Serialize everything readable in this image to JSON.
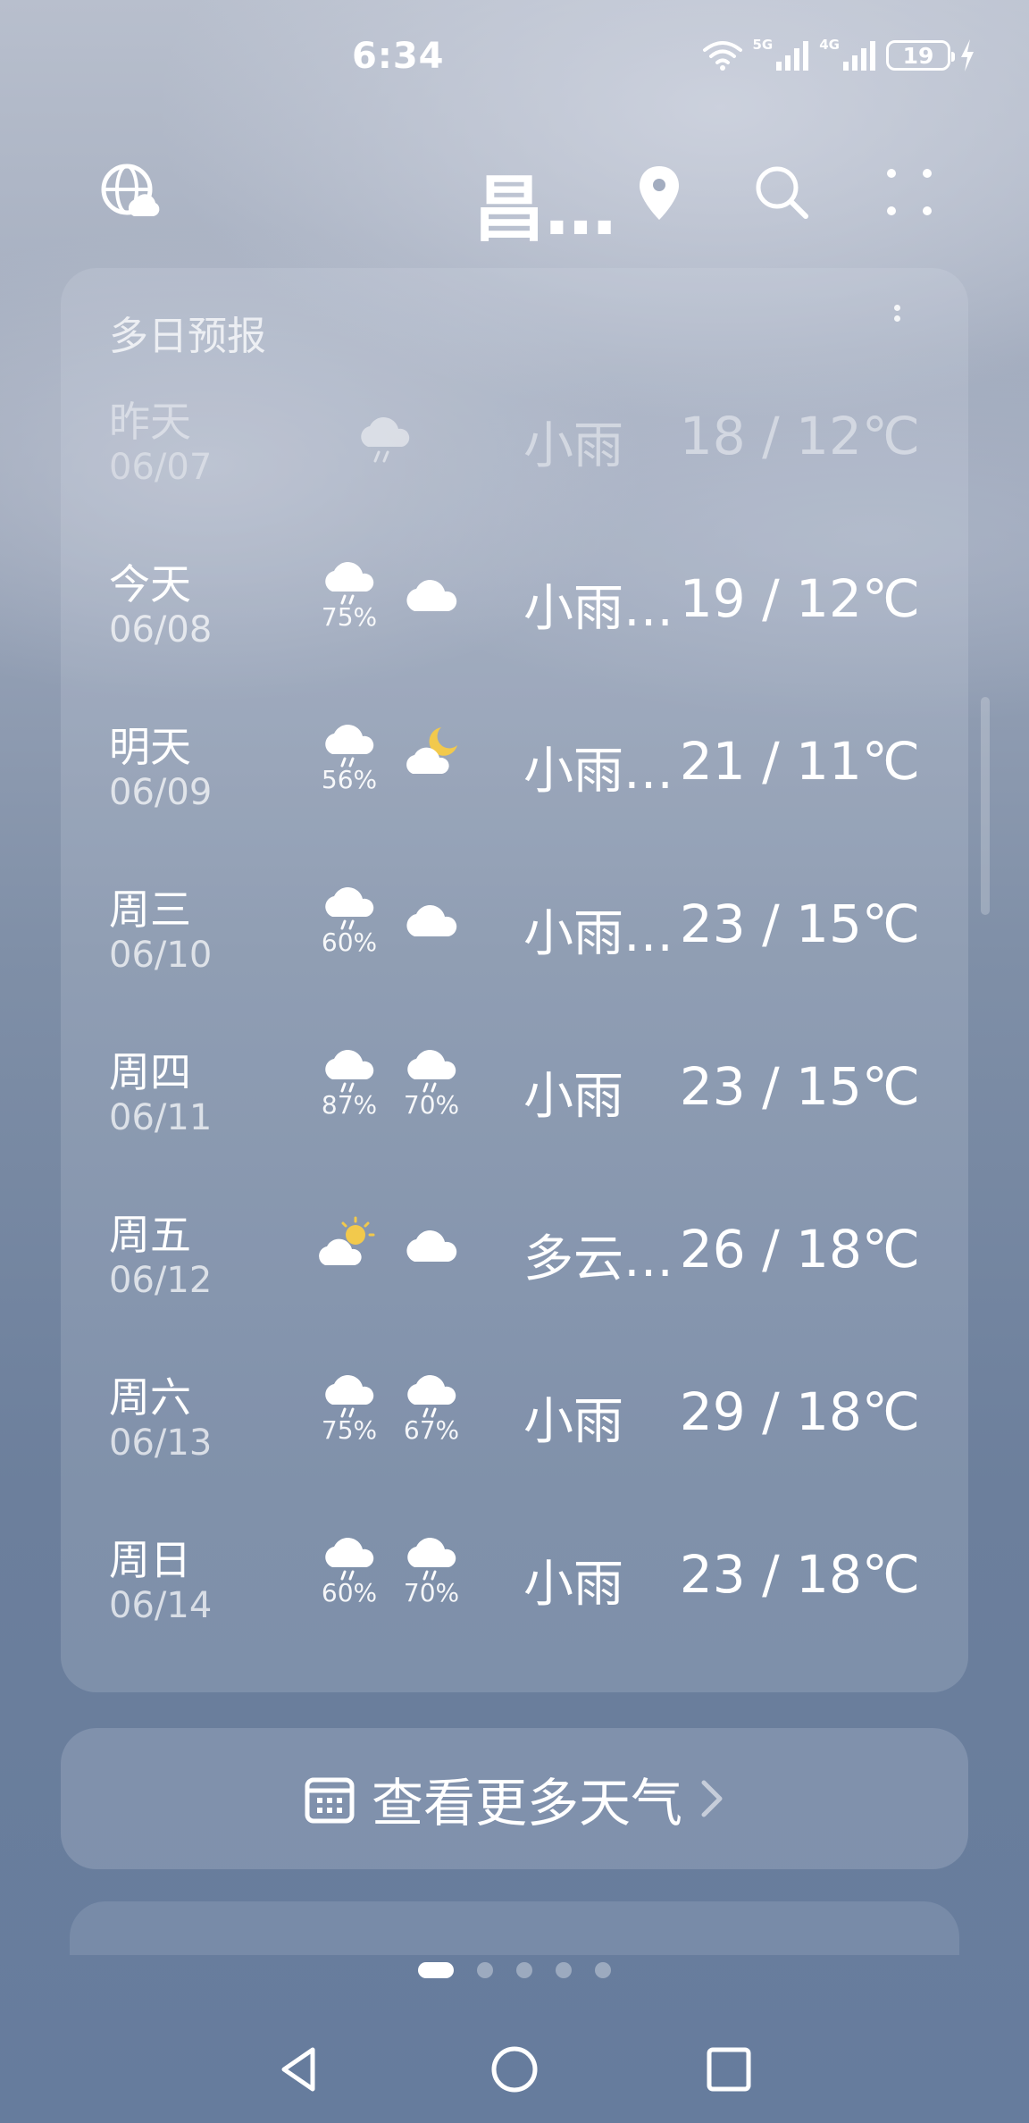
{
  "status_bar": {
    "time": "6:34",
    "signal_1_label": "5G",
    "signal_2_label": "4G",
    "battery_level": "19"
  },
  "header": {
    "city": "昌…"
  },
  "forecast": {
    "title": "多日预报",
    "days": [
      {
        "name": "昨天",
        "date": "06/07",
        "icon_day": "cloud-rain-icon",
        "precip_day": "",
        "icon_night": "",
        "precip_night": "",
        "condition": "小雨",
        "temp": "18 / 12℃",
        "past": true
      },
      {
        "name": "今天",
        "date": "06/08",
        "icon_day": "cloud-rain-icon",
        "precip_day": "75%",
        "icon_night": "cloud-icon",
        "precip_night": "",
        "condition": "小雨…",
        "temp": "19 / 12℃"
      },
      {
        "name": "明天",
        "date": "06/09",
        "icon_day": "cloud-rain-icon",
        "precip_day": "56%",
        "icon_night": "moon-cloud-icon",
        "precip_night": "",
        "condition": "小雨…",
        "temp": "21 / 11℃"
      },
      {
        "name": "周三",
        "date": "06/10",
        "icon_day": "cloud-rain-icon",
        "precip_day": "60%",
        "icon_night": "cloud-icon",
        "precip_night": "",
        "condition": "小雨…",
        "temp": "23 / 15℃"
      },
      {
        "name": "周四",
        "date": "06/11",
        "icon_day": "cloud-rain-icon",
        "precip_day": "87%",
        "icon_night": "cloud-rain-icon",
        "precip_night": "70%",
        "condition": "小雨",
        "temp": "23 / 15℃"
      },
      {
        "name": "周五",
        "date": "06/12",
        "icon_day": "sun-cloud-icon",
        "precip_day": "",
        "icon_night": "cloud-icon",
        "precip_night": "",
        "condition": "多云…",
        "temp": "26 / 18℃"
      },
      {
        "name": "周六",
        "date": "06/13",
        "icon_day": "cloud-rain-icon",
        "precip_day": "75%",
        "icon_night": "cloud-rain-icon",
        "precip_night": "67%",
        "condition": "小雨",
        "temp": "29 / 18℃"
      },
      {
        "name": "周日",
        "date": "06/14",
        "icon_day": "cloud-rain-icon",
        "precip_day": "60%",
        "icon_night": "cloud-rain-icon",
        "precip_night": "70%",
        "condition": "小雨",
        "temp": "23 / 18℃"
      }
    ]
  },
  "more_weather": {
    "label": "查看更多天气",
    "icon": "calendar-icon"
  },
  "page_indicator": {
    "current": 1,
    "total": 5
  },
  "nav": {
    "back_icon": "back-triangle-icon",
    "home_icon": "home-circle-icon",
    "recent_icon": "recent-square-icon"
  }
}
